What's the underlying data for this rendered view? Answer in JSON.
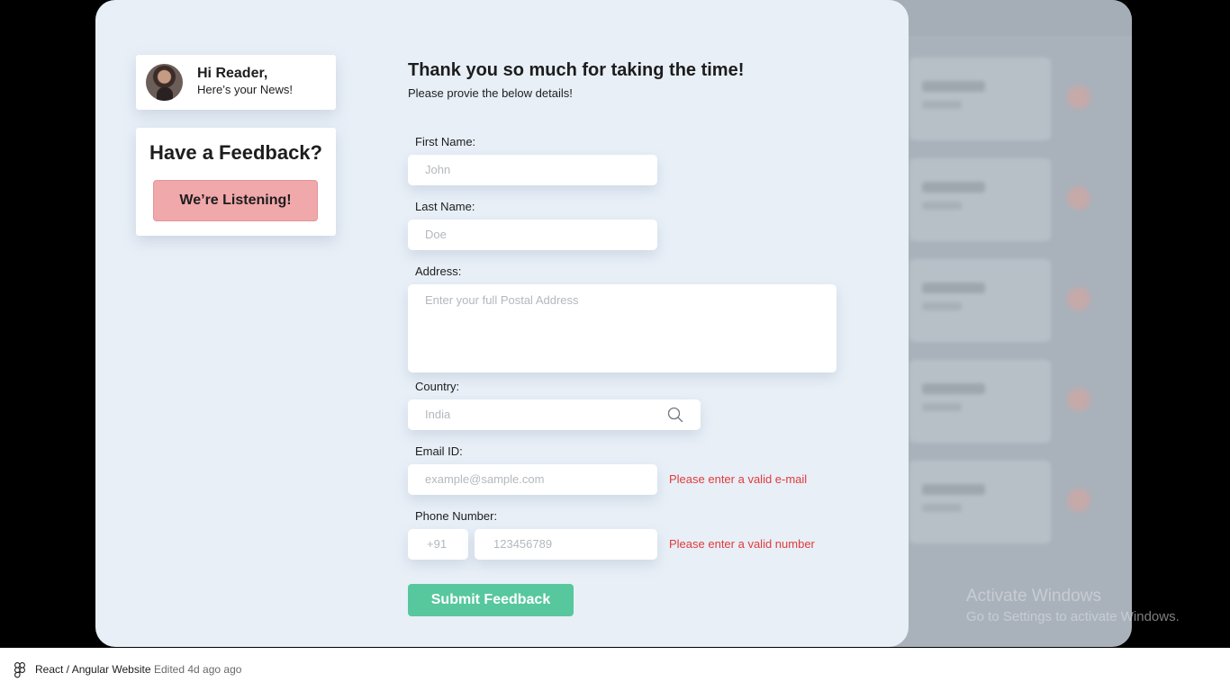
{
  "greeting": {
    "title": "Hi Reader,",
    "subtitle": "Here’s your News!"
  },
  "feedback": {
    "title": "Have a Feedback?",
    "button_label": "We’re Listening!"
  },
  "form": {
    "title": "Thank you so much for taking the time!",
    "subtitle": "Please provie the below details!",
    "first_name": {
      "label": "First Name:",
      "placeholder": "John"
    },
    "last_name": {
      "label": "Last Name:",
      "placeholder": "Doe"
    },
    "address": {
      "label": "Address:",
      "placeholder": "Enter your full Postal Address"
    },
    "country": {
      "label": "Country:",
      "placeholder": "India",
      "icon": "search-icon"
    },
    "email": {
      "label": "Email ID:",
      "placeholder": "example@sample.com",
      "error": "Please enter a valid e-mail"
    },
    "phone": {
      "label": "Phone Number:",
      "code_placeholder": "+91",
      "number_placeholder": "123456789",
      "error": "Please enter a valid number"
    },
    "submit_label": "Submit Feedback"
  },
  "watermark": {
    "title": "Activate Windows",
    "subtitle": "Go to Settings to activate Windows."
  },
  "footer": {
    "project": "React / Angular Website",
    "edited": "Edited 4d ago ago"
  },
  "colors": {
    "accent_green": "#57c79e",
    "accent_pink": "#f0a8aa",
    "error_red": "#e03b3b",
    "modal_bg": "#e8eff7"
  }
}
